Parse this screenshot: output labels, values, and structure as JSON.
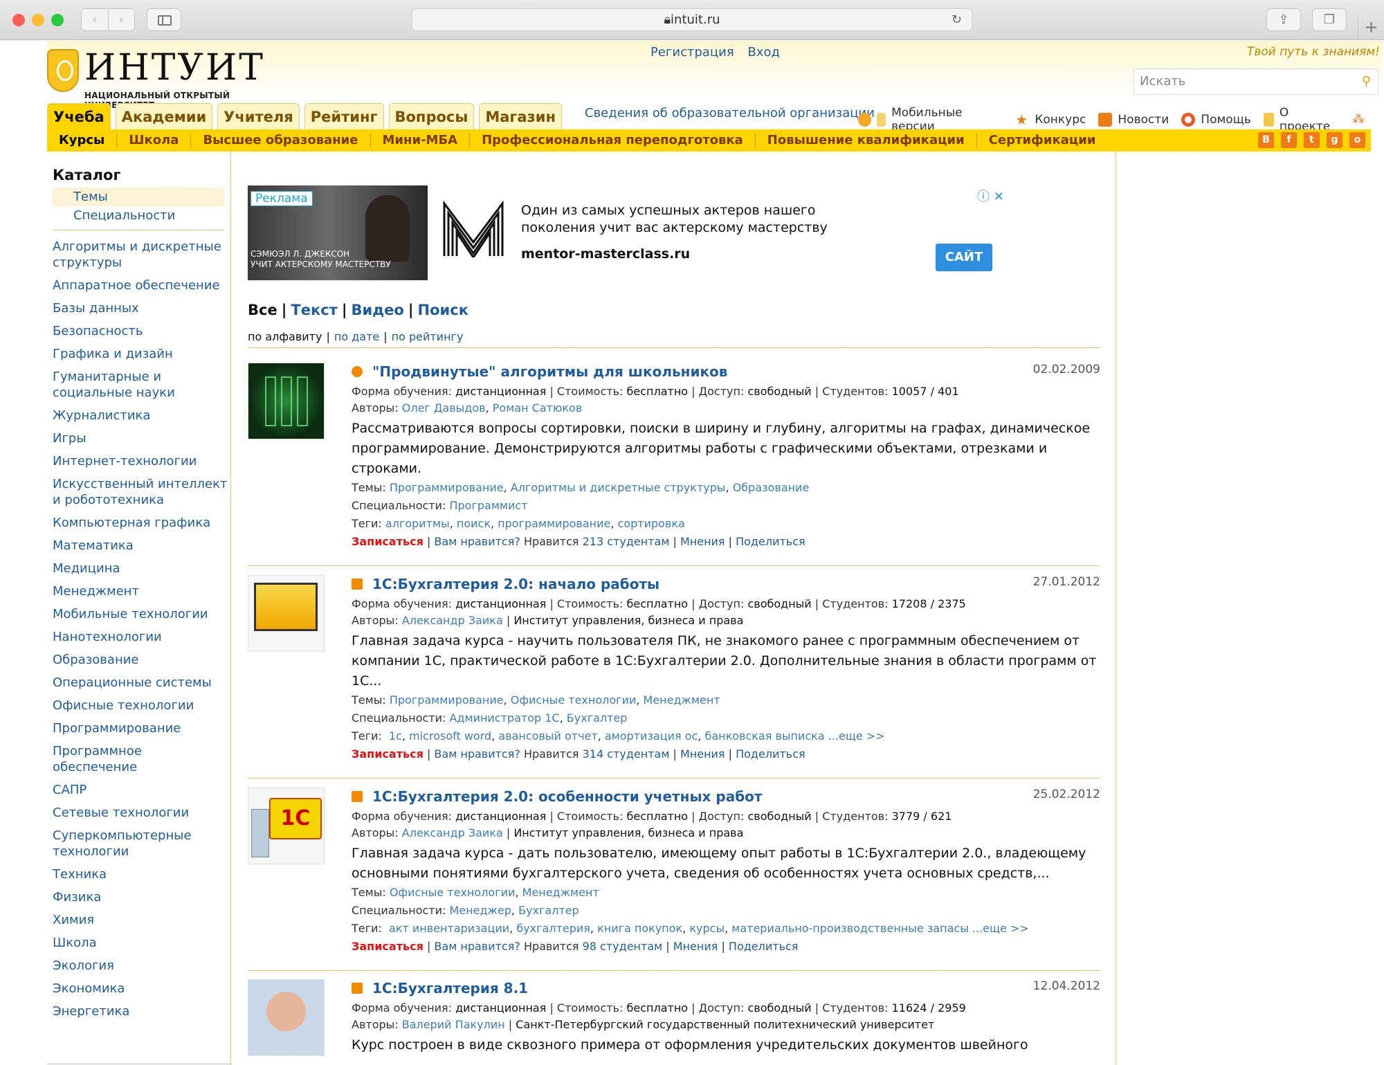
{
  "browser": {
    "url": "intuit.ru"
  },
  "header": {
    "logo_word": "ИНТУИТ",
    "logo_sub": "НАЦИОНАЛЬНЫЙ ОТКРЫТЫЙ УНИВЕРСИТЕТ",
    "register": "Регистрация",
    "login": "Вход",
    "slogan": "Твой путь к знаниям!",
    "search_placeholder": "Искать"
  },
  "tabs": [
    "Учеба",
    "Академии",
    "Учителя",
    "Рейтинг",
    "Вопросы",
    "Магазин"
  ],
  "org_info": "Сведения об образовательной организации",
  "top_links": [
    "Мобильные версии",
    "Конкурс",
    "Новости",
    "Помощь",
    "О проекте"
  ],
  "categories": [
    "Курсы",
    "Школа",
    "Высшее образование",
    "Мини-МБА",
    "Профессиональная переподготовка",
    "Повышение квалификации",
    "Сертификации"
  ],
  "sidebar": {
    "title": "Каталог",
    "sub": [
      "Темы",
      "Специальности"
    ],
    "topics": [
      "Алгоритмы и дискретные структуры",
      "Аппаратное обеспечение",
      "Базы данных",
      "Безопасность",
      "Графика и дизайн",
      "Гуманитарные и социальные науки",
      "Журналистика",
      "Игры",
      "Интернет-технологии",
      "Искусственный интеллект и робототехника",
      "Компьютерная графика",
      "Математика",
      "Медицина",
      "Менеджмент",
      "Мобильные технологии",
      "Нанотехнологии",
      "Образование",
      "Операционные системы",
      "Офисные технологии",
      "Программирование",
      "Программное обеспечение",
      "САПР",
      "Сетевые технологии",
      "Суперкомпьютерные технологии",
      "Техника",
      "Физика",
      "Химия",
      "Школа",
      "Экология",
      "Экономика",
      "Энергетика"
    ]
  },
  "ad": {
    "label": "Реклама",
    "caption1": "СЭМЮЭЛ Л. ДЖЕКСОН",
    "caption2": "УЧИТ АКТЕРСКОМУ МАСТЕРСТВУ",
    "text": "Один из самых успешных актеров нашего поколения учит вас актерскому мастерству",
    "domain": "mentor-masterclass.ru",
    "button": "САЙТ"
  },
  "filters": {
    "all": "Все",
    "text": "Текст",
    "video": "Видео",
    "search": "Поиск"
  },
  "sort": {
    "alpha": "по алфавиту",
    "date": "по дате",
    "rating": "по рейтингу"
  },
  "labels": {
    "form": "Форма обучения:",
    "cost": "Стоимость:",
    "access": "Доступ:",
    "students": "Студентов:",
    "authors": "Авторы:",
    "topics": "Темы:",
    "specs": "Специальности:",
    "tags": "Теги:",
    "enroll": "Записаться",
    "like": "Вам нравится?",
    "likes_prefix": "Нравится",
    "likes_suffix": "студентам",
    "opinions": "Мнения",
    "share": "Поделиться"
  },
  "courses": [
    {
      "title": "\"Продвинутые\" алгоритмы для школьников",
      "date": "02.02.2009",
      "form": "дистанционная",
      "cost": "бесплатно",
      "access": "свободный",
      "students": "10057 / 401",
      "authors": [
        "Олег Давыдов",
        "Роман Сатюков"
      ],
      "org": "",
      "desc": "Рассматриваются вопросы сортировки, поиски в ширину и глубину, алгоритмы на графах, динамическое программирование. Демонстрируются алгоритмы работы с графическими объектами, отрезками и строками.",
      "topics": [
        "Программирование",
        "Алгоритмы и дискретные структуры",
        "Образование"
      ],
      "specs": [
        "Программист"
      ],
      "tags": [
        "алгоритмы",
        "поиск",
        "программирование",
        "сортировка"
      ],
      "more": "",
      "likes": "213"
    },
    {
      "title": "1С:Бухгалтерия 2.0: начало работы",
      "date": "27.01.2012",
      "form": "дистанционная",
      "cost": "бесплатно",
      "access": "свободный",
      "students": "17208 / 2375",
      "authors": [
        "Александр Заика"
      ],
      "org": "Институт управления, бизнеса и права",
      "desc": "Главная задача курса - научить пользователя ПК, не знакомого ранее с программным обеспечением от компании 1С, практической работе в 1С:Бухгалтерии 2.0. Дополнительные знания в области программ от 1С...",
      "topics": [
        "Программирование",
        "Офисные технологии",
        "Менеджмент"
      ],
      "specs": [
        "Администратор 1С",
        "Бухгалтер"
      ],
      "tags": [
        "1с",
        "microsoft word",
        "авансовый отчет",
        "амортизация ос",
        "банковская выписка"
      ],
      "more": "...еще >>",
      "likes": "314"
    },
    {
      "title": "1С:Бухгалтерия 2.0: особенности учетных работ",
      "date": "25.02.2012",
      "form": "дистанционная",
      "cost": "бесплатно",
      "access": "свободный",
      "students": "3779 / 621",
      "authors": [
        "Александр Заика"
      ],
      "org": "Институт управления, бизнеса и права",
      "desc": "Главная задача курса - дать пользователю, имеющему опыт работы в 1С:Бухгалтерии 2.0., владеющему основными понятиями бухгалтерского учета, сведения об особенностях учета основных средств,...",
      "topics": [
        "Офисные технологии",
        "Менеджмент"
      ],
      "specs": [
        "Менеджер",
        "Бухгалтер"
      ],
      "tags": [
        "акт инвентаризации",
        "бухгалтерия",
        "книга покупок",
        "курсы",
        "материально-производственные запасы"
      ],
      "more": "...еще >>",
      "likes": "98"
    },
    {
      "title": "1С:Бухгалтерия 8.1",
      "date": "12.04.2012",
      "form": "дистанционная",
      "cost": "бесплатно",
      "access": "свободный",
      "students": "11624 / 2959",
      "authors": [
        "Валерий Пакулин"
      ],
      "org": "Санкт-Петербургский государственный политехнический университет",
      "desc": "Курс построен в виде сквозного примера от оформления учредительских документов швейного",
      "topics": [],
      "specs": [],
      "tags": [],
      "more": "",
      "likes": ""
    }
  ],
  "colors": {
    "accent": "#fdd400",
    "link": "#1f5c99",
    "enroll": "#e21212",
    "border": "#e8c46c"
  }
}
